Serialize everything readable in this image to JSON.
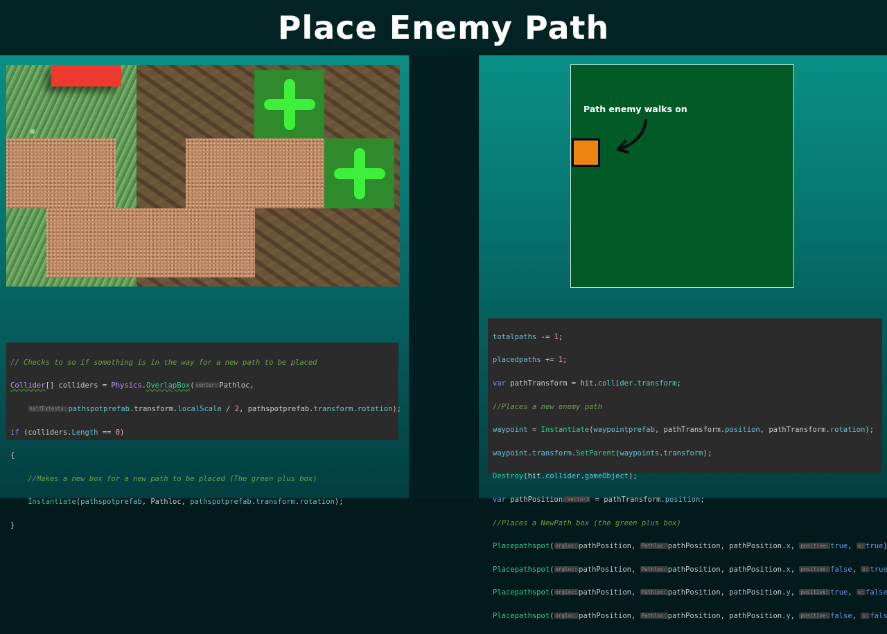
{
  "title": "Place Enemy Path",
  "diagram": {
    "label": "Path enemy walks on"
  },
  "left_code": {
    "comment1": "// Checks to so if something is in the way for a new path to be placed",
    "line2": {
      "type": "Collider",
      "a": "[] colliders = ",
      "cls": "Physics",
      "dot": ".",
      "method": "OverlapBox",
      "paren": "(",
      "hint": "center:",
      "arg": "Pathloc,"
    },
    "line3": {
      "hint": "halfExtents:",
      "a": "pathspotprefab",
      "b": ".transform.",
      "c": "localScale",
      "d": " / ",
      "e": "2",
      "f": ", pathspotprefab.",
      "g": "transform",
      "h": ".",
      "i": "rotation",
      "j": ");"
    },
    "line4": {
      "kw": "if",
      "a": " (colliders.",
      "fld": "Length",
      "b": " == ",
      "num": "0",
      "c": ")"
    },
    "open": "{",
    "comment2": "//Makes a new box for a new path to be placed (The green plus box)",
    "line7": {
      "fn": "Instantiate",
      "a": "(",
      "b": "pathspotprefab",
      "c": ", Pathloc, ",
      "d": "pathspotprefab",
      "e": ".",
      "f": "transform",
      "g": ".",
      "h": "rotation",
      "i": ");"
    },
    "close": "}"
  },
  "right_code": {
    "l1": {
      "fld": "totalpaths",
      "a": " -= ",
      "num": "1",
      "b": ";"
    },
    "l2": {
      "fld": "placedpaths",
      "a": " += ",
      "num": "1",
      "b": ";"
    },
    "l3": {
      "kw": "var",
      "a": " pathTransform = hit.",
      "b": "collider",
      "c": ".",
      "d": "transform",
      "e": ";"
    },
    "l4": "//Places a new enemy path",
    "l5": {
      "fld": "waypoint",
      "a": " = ",
      "fn": "Instantiate",
      "b": "(",
      "c": "waypointprefab",
      "d": ", pathTransform.",
      "e": "position",
      "f": ", pathTransform.",
      "g": "rotation",
      "h": ");"
    },
    "l6": {
      "fld": "waypoint",
      "a": ".",
      "b": "transform",
      "c": ".",
      "fn": "SetParent",
      "d": "(",
      "e": "waypoints",
      "f": ".",
      "g": "transform",
      "h": ");"
    },
    "l7": {
      "fn": "Destroy",
      "a": "(hit.",
      "b": "collider",
      "c": ".",
      "d": "gameObject",
      "e": ");"
    },
    "l8": {
      "kw": "var",
      "a": " pathPosition",
      "hint": ":Vector3",
      "b": " = pathTransform.",
      "c": "position",
      "d": ";"
    },
    "l9": "//Places a NewPath box (the green plus box)",
    "place_calls": [
      {
        "fn": "Placepathspot",
        "h1": "orgloc:",
        "a1": "pathPosition,",
        "h2": "Pathloc:",
        "a2": "pathPosition, pathPosition.",
        "axis": "x",
        "h3": "positive:",
        "pos": "true",
        "h4": "x:",
        "xv": "true",
        "end": ");"
      },
      {
        "fn": "Placepathspot",
        "h1": "orgloc:",
        "a1": "pathPosition,",
        "h2": "Pathloc:",
        "a2": "pathPosition, pathPosition.",
        "axis": "x",
        "h3": "positive:",
        "pos": "false",
        "h4": "x:",
        "xv": "true",
        "end": ");"
      },
      {
        "fn": "Placepathspot",
        "h1": "orgloc:",
        "a1": "pathPosition,",
        "h2": "Pathloc:",
        "a2": "pathPosition, pathPosition.",
        "axis": "y",
        "h3": "positive:",
        "pos": "true",
        "h4": "x:",
        "xv": "false",
        "end": ");"
      },
      {
        "fn": "Placepathspot",
        "h1": "orgloc:",
        "a1": "pathPosition,",
        "h2": "Pathloc:",
        "a2": "pathPosition, pathPosition.",
        "axis": "y",
        "h3": "positive:",
        "pos": "false",
        "h4": "x:",
        "xv": "false",
        "end": ");"
      }
    ]
  },
  "colors": {
    "plus": "#3ef03a",
    "plus_tile": "#2f8a2c",
    "red_block": "#ee3a2e",
    "path_marker": "#ee8411",
    "diagram_bg": "#025a26"
  }
}
